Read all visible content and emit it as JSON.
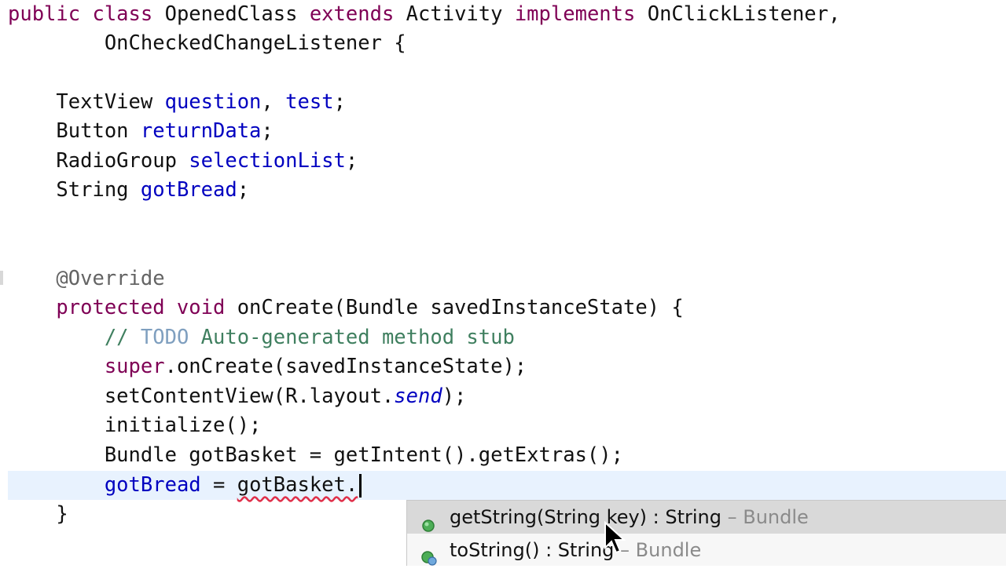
{
  "code_lines": [
    [
      {
        "t": "public class ",
        "c": "kw"
      },
      {
        "t": "OpenedClass ",
        "c": ""
      },
      {
        "t": "extends ",
        "c": "kw"
      },
      {
        "t": "Activity ",
        "c": ""
      },
      {
        "t": "implements ",
        "c": "kw"
      },
      {
        "t": "OnClickListener,",
        "c": ""
      }
    ],
    [
      {
        "t": "        OnCheckedChangeListener {",
        "c": ""
      }
    ],
    [],
    [
      {
        "t": "    TextView ",
        "c": ""
      },
      {
        "t": "question",
        "c": "fld"
      },
      {
        "t": ", ",
        "c": ""
      },
      {
        "t": "test",
        "c": "fld"
      },
      {
        "t": ";",
        "c": ""
      }
    ],
    [
      {
        "t": "    Button ",
        "c": ""
      },
      {
        "t": "returnData",
        "c": "fld"
      },
      {
        "t": ";",
        "c": ""
      }
    ],
    [
      {
        "t": "    RadioGroup ",
        "c": ""
      },
      {
        "t": "selectionList",
        "c": "fld"
      },
      {
        "t": ";",
        "c": ""
      }
    ],
    [
      {
        "t": "    String ",
        "c": ""
      },
      {
        "t": "gotBread",
        "c": "fld"
      },
      {
        "t": ";",
        "c": ""
      }
    ],
    [],
    [],
    [
      {
        "t": "    @Override",
        "c": "ann"
      }
    ],
    [
      {
        "t": "    protected void ",
        "c": "kw"
      },
      {
        "t": "onCreate(Bundle savedInstanceState) {",
        "c": ""
      }
    ],
    [
      {
        "t": "        // ",
        "c": "cmt"
      },
      {
        "t": "TODO",
        "c": "todo"
      },
      {
        "t": " Auto-generated method stub",
        "c": "cmt"
      }
    ],
    [
      {
        "t": "        super",
        "c": "kw"
      },
      {
        "t": ".onCreate(savedInstanceState);",
        "c": ""
      }
    ],
    [
      {
        "t": "        setContentView(R.layout.",
        "c": ""
      },
      {
        "t": "send",
        "c": "ital"
      },
      {
        "t": ");",
        "c": ""
      }
    ],
    [
      {
        "t": "        initialize();",
        "c": ""
      }
    ],
    [
      {
        "t": "        Bundle gotBasket = getIntent().getExtras();",
        "c": ""
      }
    ],
    [
      {
        "t": "        ",
        "c": ""
      },
      {
        "t": "gotBread",
        "c": "fld"
      },
      {
        "t": " = ",
        "c": ""
      },
      {
        "t": "gotBasket.",
        "c": "err"
      }
    ],
    [
      {
        "t": "    }",
        "c": ""
      }
    ]
  ],
  "autocomplete": {
    "items": [
      {
        "label": "getString(String key) : String",
        "decl": " – Bundle",
        "icon": "public-method-icon",
        "selected": true
      },
      {
        "label": "toString() : String",
        "decl": " – Bundle",
        "icon": "override-method-icon",
        "selected": false
      }
    ]
  },
  "colors": {
    "keyword": "#7f0055",
    "field": "#0000c0",
    "comment": "#3f7f5f",
    "annotation": "#646464",
    "current_line": "#e8f2fe",
    "error_underline": "#e0304a"
  }
}
